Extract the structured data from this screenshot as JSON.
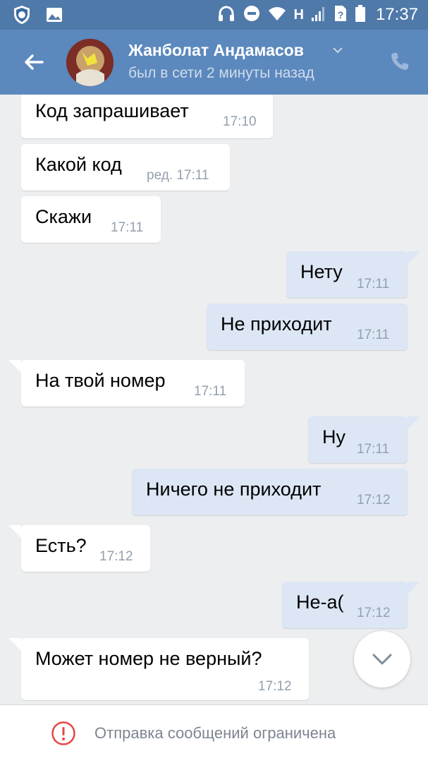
{
  "status_bar": {
    "network_letter": "H",
    "time": "17:37"
  },
  "header": {
    "contact_name": "Жанболат Андамасов",
    "last_seen": "был в сети 2 минуты назад"
  },
  "messages": [
    {
      "direction": "in",
      "text": "Код запрашивает",
      "time": "17:10"
    },
    {
      "direction": "in",
      "text": "Какой код",
      "time": "ред. 17:11"
    },
    {
      "direction": "in",
      "text": "Скажи",
      "time": "17:11"
    },
    {
      "direction": "out",
      "text": "Нету",
      "time": "17:11"
    },
    {
      "direction": "out",
      "text": "Не приходит",
      "time": "17:11"
    },
    {
      "direction": "in",
      "text": "На твой номер",
      "time": "17:11"
    },
    {
      "direction": "out",
      "text": "Ну",
      "time": "17:11"
    },
    {
      "direction": "out",
      "text": "Ничего не приходит",
      "time": "17:12"
    },
    {
      "direction": "in",
      "text": "Есть?",
      "time": "17:12"
    },
    {
      "direction": "out",
      "text": "Не-а(",
      "time": "17:12"
    },
    {
      "direction": "in",
      "text": "Может номер не верный?",
      "time": "17:12"
    }
  ],
  "footer": {
    "notice": "Отправка сообщений ограничена"
  },
  "colors": {
    "header_bg": "#5b88bd",
    "status_bg": "#4f79a9",
    "chat_bg": "#edeef0",
    "outgoing_bubble": "#dce6f4",
    "incoming_bubble": "#ffffff",
    "warning_red": "#e64646"
  },
  "icons": [
    "shield-icon",
    "image-icon",
    "headphones-icon",
    "do-not-disturb-icon",
    "wifi-icon",
    "signal-icon",
    "sim-unknown-icon",
    "battery-icon",
    "back-arrow-icon",
    "chevron-down-icon",
    "phone-icon",
    "scroll-down-icon",
    "warning-icon"
  ]
}
